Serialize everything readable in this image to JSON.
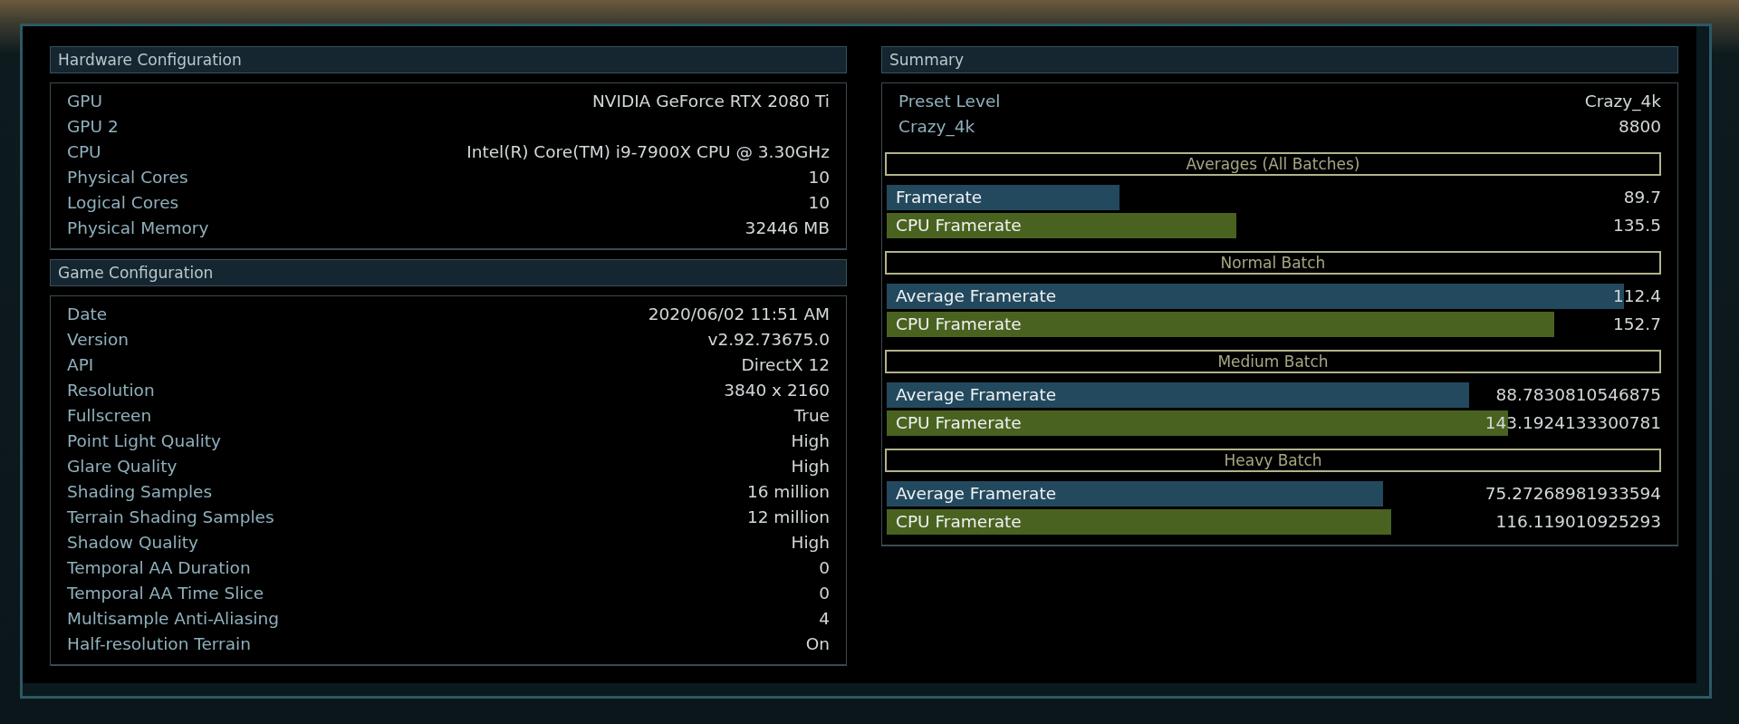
{
  "hardware_configuration": {
    "title": "Hardware Configuration",
    "rows": [
      {
        "label": "GPU",
        "value": "NVIDIA GeForce RTX 2080 Ti"
      },
      {
        "label": "GPU 2"
      },
      {
        "label": "CPU",
        "value": "Intel(R) Core(TM) i9-7900X CPU @ 3.30GHz"
      },
      {
        "label": "Physical Cores",
        "value": "10"
      },
      {
        "label": "Logical Cores",
        "value": "10"
      },
      {
        "label": "Physical Memory",
        "value": "32446 MB"
      }
    ]
  },
  "game_configuration": {
    "title": "Game Configuration",
    "rows": [
      {
        "label": "Date",
        "value": "2020/06/02 11:51 AM"
      },
      {
        "label": "Version",
        "value": "v2.92.73675.0"
      },
      {
        "label": "API",
        "value": "DirectX 12"
      },
      {
        "label": "Resolution",
        "value": "3840 x 2160"
      },
      {
        "label": "Fullscreen",
        "value": "True"
      },
      {
        "label": "Point Light Quality",
        "value": "High"
      },
      {
        "label": "Glare Quality",
        "value": "High"
      },
      {
        "label": "Shading Samples",
        "value": "16 million"
      },
      {
        "label": "Terrain Shading Samples",
        "value": "12 million"
      },
      {
        "label": "Shadow Quality",
        "value": "High"
      },
      {
        "label": "Temporal AA Duration",
        "value": "0"
      },
      {
        "label": "Temporal AA Time Slice",
        "value": "0"
      },
      {
        "label": "Multisample Anti-Aliasing",
        "value": "4"
      },
      {
        "label": "Half-resolution Terrain",
        "value": "On"
      }
    ]
  },
  "summary": {
    "title": "Summary",
    "rows": [
      {
        "label": "Preset Level",
        "value": "Crazy_4k"
      },
      {
        "label": "Crazy_4k",
        "value": "8800"
      }
    ],
    "sections": [
      {
        "title": "Averages (All Batches)",
        "bars": [
          {
            "kind": "gpu",
            "label": "Framerate",
            "value": "89.7",
            "level": 0.3
          },
          {
            "kind": "cpu",
            "label": "CPU Framerate",
            "value": "135.5",
            "level": 0.45
          }
        ]
      },
      {
        "title": "Normal Batch",
        "bars": [
          {
            "kind": "gpu",
            "label": "Average Framerate",
            "value": "112.4",
            "level": 0.95
          },
          {
            "kind": "cpu",
            "label": "CPU Framerate",
            "value": "152.7",
            "level": 0.86
          }
        ]
      },
      {
        "title": "Medium Batch",
        "bars": [
          {
            "kind": "gpu",
            "label": "Average Framerate",
            "value": "88.7830810546875",
            "level": 0.75
          },
          {
            "kind": "cpu",
            "label": "CPU Framerate",
            "value": "143.1924133300781",
            "level": 0.8
          }
        ]
      },
      {
        "title": "Heavy Batch",
        "bars": [
          {
            "kind": "gpu",
            "label": "Average Framerate",
            "value": "75.27268981933594",
            "level": 0.64
          },
          {
            "kind": "cpu",
            "label": "CPU Framerate",
            "value": "116.119010925293",
            "level": 0.65
          }
        ]
      }
    ]
  }
}
